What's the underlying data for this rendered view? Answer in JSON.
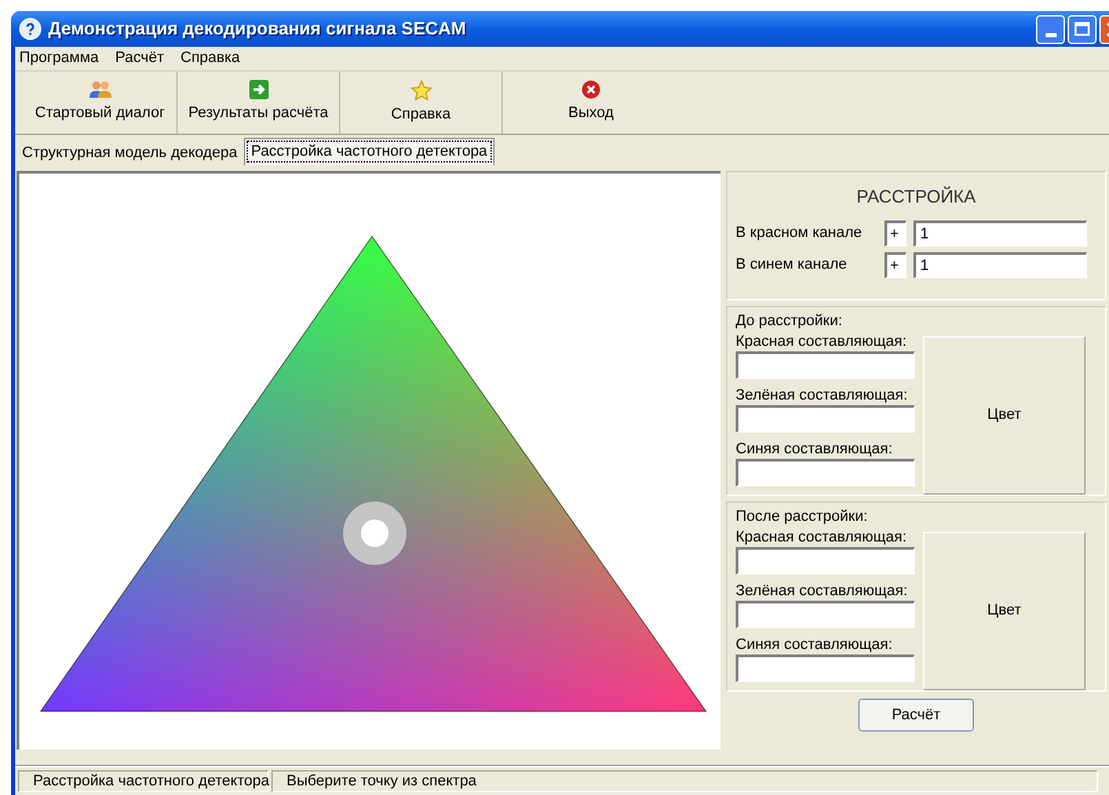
{
  "window": {
    "title": "Демонстрация декодирования сигнала SECAM"
  },
  "menu": [
    "Программа",
    "Расчёт",
    "Справка"
  ],
  "toolbar": [
    {
      "label": "Стартовый диалог",
      "kind": "people"
    },
    {
      "label": "Результаты расчёта",
      "kind": "arrow"
    },
    {
      "label": "Справка",
      "kind": "star"
    },
    {
      "label": "Выход",
      "kind": "exit"
    }
  ],
  "tabs": [
    {
      "label": "Структурная модель декодера",
      "selected": false
    },
    {
      "label": "Расстройка частотного детектора",
      "selected": true
    }
  ],
  "detuning": {
    "title": "РАССТРОЙКА",
    "rows": [
      {
        "label": "В красном канале",
        "sign": "+",
        "value": "1"
      },
      {
        "label": "В синем канале",
        "sign": "+",
        "value": "1"
      }
    ]
  },
  "groups": [
    {
      "title": "До расстройки:",
      "fields": [
        {
          "label": "Красная составляющая:"
        },
        {
          "label": "Зелёная составляющая:"
        },
        {
          "label": "Синяя составляющая:"
        }
      ],
      "color_button": "Цвет"
    },
    {
      "title": "После расстройки:",
      "fields": [
        {
          "label": "Красная составляющая:"
        },
        {
          "label": "Зелёная составляющая:"
        },
        {
          "label": "Синяя составляющая:"
        }
      ],
      "color_button": "Цвет"
    }
  ],
  "calculate_button": "Расчёт",
  "status_bar": [
    "Расстройка частотного детектора",
    "Выберите точку из спектра"
  ]
}
